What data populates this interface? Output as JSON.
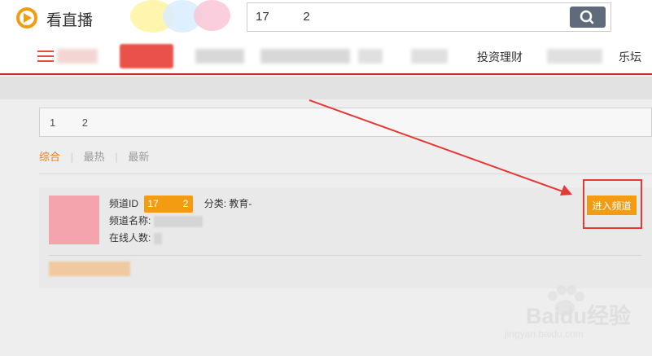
{
  "app": {
    "title": "看直播"
  },
  "search": {
    "value": "17          2"
  },
  "nav": {
    "items": [
      {
        "label": ""
      },
      {
        "label": ""
      },
      {
        "label": "投资理财"
      },
      {
        "label": "乐坛"
      }
    ]
  },
  "query_panel": {
    "text": "1         2"
  },
  "tabs": [
    {
      "label": "综合"
    },
    {
      "label": "最热"
    },
    {
      "label": "最新"
    }
  ],
  "tab_separator": "|",
  "result": {
    "id_label": "频道ID",
    "id_value": "17         2",
    "category_label": "分类:",
    "category_value": "教育-",
    "name_label": "频道名称:",
    "online_label": "在线人数:",
    "enter_button": "进入频道"
  },
  "watermark": {
    "brand": "Baidu经验",
    "url": "jingyan.baidu.com"
  },
  "colors": {
    "accent": "#f39c12",
    "nav_underline": "#c62828",
    "annotation": "#e53935"
  }
}
